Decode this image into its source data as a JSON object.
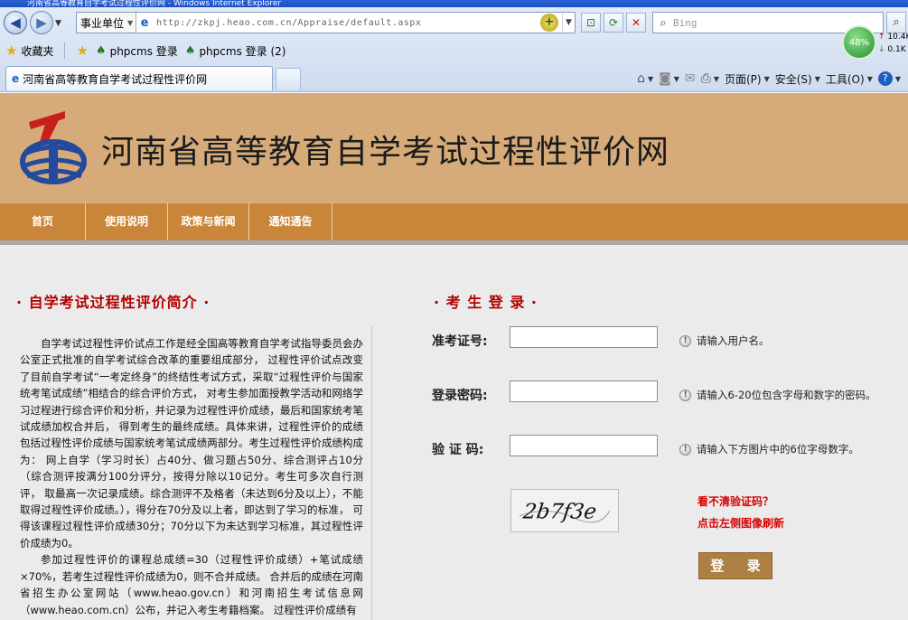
{
  "browser": {
    "window_title": "河南省高等教育自学考试过程性评价网 - Windows Internet Explorer",
    "address": {
      "favorite_dropdown": "事业单位",
      "url": "http://zkpj.heao.com.cn/Appraise/default.aspx"
    },
    "search": {
      "placeholder": "Bing"
    },
    "favorites_bar": {
      "favorites_label": "收藏夹",
      "items": [
        "phpcms 登录",
        "phpcms 登录 (2)"
      ]
    },
    "network_widget": {
      "percent": "48%",
      "up": "10.4K",
      "down": "0.1K"
    },
    "tab": {
      "title": "河南省高等教育自学考试过程性评价网"
    },
    "commands": {
      "page": "页面(P)",
      "safety": "安全(S)",
      "tools": "工具(O)",
      "help": "?"
    }
  },
  "site": {
    "title": "河南省高等教育自学考试过程性评价网",
    "nav": [
      "首页",
      "使用说明",
      "政策与新闻",
      "通知通告"
    ],
    "intro": {
      "heading": "· 自学考试过程性评价简介 ·",
      "paragraphs": [
        "自学考试过程性评价试点工作是经全国高等教育自学考试指导委员会办公室正式批准的自学考试综合改革的重要组成部分， 过程性评价试点改变了目前自学考试“一考定终身”的终结性考试方式，采取“过程性评价与国家统考笔试成绩”相结合的综合评价方式， 对考生参加面授教学活动和网络学习过程进行综合评价和分析，并记录为过程性评价成绩，最后和国家统考笔试成绩加权合并后， 得到考生的最终成绩。具体来讲，过程性评价的成绩包括过程性评价成绩与国家统考笔试成绩两部分。考生过程性评价成绩构成为： 网上自学（学习时长）占40分、做习题占50分、综合测评占10分（综合测评按满分100分评分，按得分除以10记分。考生可多次自行测评， 取最高一次记录成绩。综合测评不及格者（未达到6分及以上），不能取得过程性评价成绩。），得分在70分及以上者，即达到了学习的标准， 可得该课程过程性评价成绩30分；70分以下为未达到学习标准，其过程性评价成绩为0。",
        "参加过程性评价的课程总成绩=30（过程性评价成绩）+笔试成绩×70%，若考生过程性评价成绩为0，则不合并成绩。 合并后的成绩在河南省招生办公室网站（www.heao.gov.cn）和河南招生考试信息网（www.heao.com.cn）公布，并记入考生考籍档案。 过程性评价成绩有"
      ]
    },
    "login": {
      "heading": "· 考 生 登 录 ·",
      "fields": [
        {
          "label": "准考证号:",
          "value": "",
          "hint": "请输入用户名。"
        },
        {
          "label": "登录密码:",
          "value": "",
          "hint": "请输入6-20位包含字母和数字的密码。"
        },
        {
          "label": "验 证 码:",
          "value": "",
          "hint": "请输入下方图片中的6位字母数字。"
        }
      ],
      "captcha_text": "2b7f3e",
      "captcha_help_1": "看不清验证码？",
      "captcha_help_2": "点击左侧图像刷新",
      "button": "登 录"
    }
  },
  "colors": {
    "banner": "#d6ab79",
    "nav": "#c9853a",
    "heading_red": "#b20000",
    "login_button": "#ad7f42",
    "captcha_help_red": "#d80000"
  }
}
